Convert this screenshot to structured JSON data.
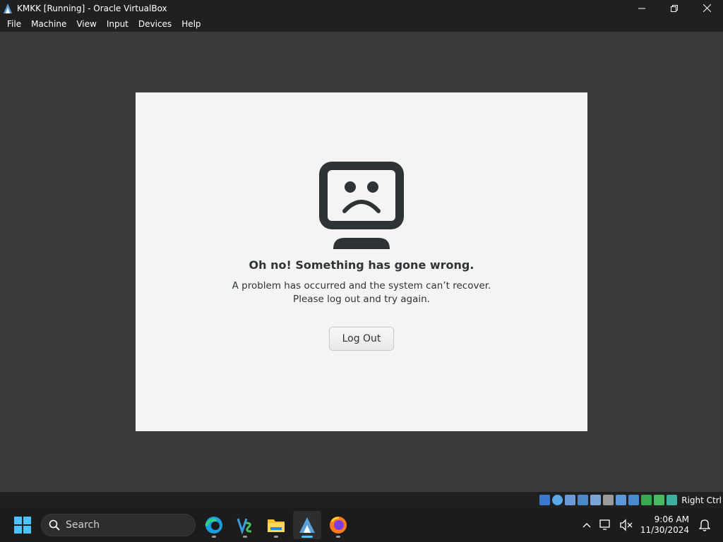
{
  "window": {
    "title": "KMKK [Running] - Oracle VirtualBox"
  },
  "menu": [
    "File",
    "Machine",
    "View",
    "Input",
    "Devices",
    "Help"
  ],
  "dialog": {
    "headline": "Oh no!  Something has gone wrong.",
    "line1": "A problem has occurred and the system can’t recover.",
    "line2": "Please log out and try again.",
    "button": "Log Out"
  },
  "statusbar": {
    "host_key": "Right Ctrl"
  },
  "taskbar": {
    "search_label": "Search",
    "time": "9:06 AM",
    "date": "11/30/2024"
  },
  "colors": {
    "accent": "#4cc2ff",
    "dialog_bg": "#f4f4f4",
    "guest_bg": "#3b3b3b"
  }
}
